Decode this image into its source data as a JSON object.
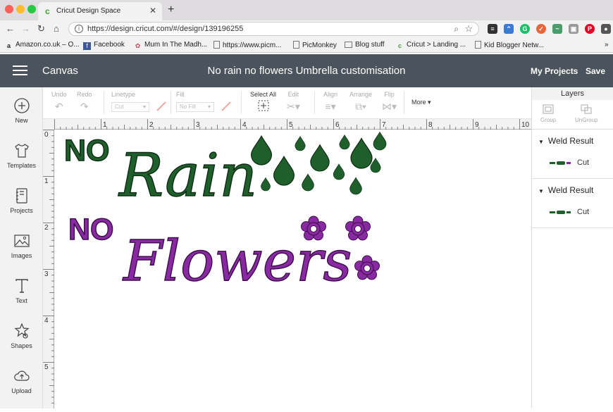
{
  "browser": {
    "tab_title": "Cricut Design Space",
    "url": "https://design.cricut.com/#/design/139196255",
    "bookmarks": [
      {
        "label": "Amazon.co.uk – O..."
      },
      {
        "label": "Facebook"
      },
      {
        "label": "Mum In The Madh..."
      },
      {
        "label": "https://www.picm..."
      },
      {
        "label": "PicMonkey"
      },
      {
        "label": "Blog stuff"
      },
      {
        "label": "Cricut > Landing ..."
      },
      {
        "label": "Kid Blogger Netw..."
      }
    ]
  },
  "app": {
    "section": "Canvas",
    "project_title": "No rain no flowers Umbrella customisation",
    "my_projects_label": "My Projects",
    "save_label": "Save"
  },
  "sidebar": {
    "items": [
      {
        "label": "New",
        "icon": "plus-circle-icon"
      },
      {
        "label": "Templates",
        "icon": "shirt-icon"
      },
      {
        "label": "Projects",
        "icon": "notebook-icon"
      },
      {
        "label": "Images",
        "icon": "image-icon"
      },
      {
        "label": "Text",
        "icon": "text-t-icon"
      },
      {
        "label": "Shapes",
        "icon": "shapes-icon"
      },
      {
        "label": "Upload",
        "icon": "cloud-upload-icon"
      }
    ]
  },
  "toolbar": {
    "undo": "Undo",
    "redo": "Redo",
    "linetype": "Linetype",
    "linetype_value": "Cut",
    "fill": "Fill",
    "fill_value": "No Fill",
    "select_all": "Select All",
    "edit": "Edit",
    "align": "Align",
    "arrange": "Arrange",
    "flip": "Flip",
    "more": "More"
  },
  "ruler": {
    "h_labels": [
      "1",
      "2",
      "3",
      "4",
      "5",
      "6",
      "7",
      "8",
      "9",
      "10"
    ],
    "v_labels": [
      "0",
      "1",
      "2",
      "3",
      "4",
      "5"
    ]
  },
  "canvas": {
    "line1_small": "NO",
    "line1_script": "Rain",
    "line2_small": "NO",
    "line2_script": "Flowers",
    "rain_color": "#1f5f2c",
    "flower_color": "#8a2aa3"
  },
  "layers": {
    "header": "Layers",
    "group_label": "Group",
    "ungroup_label": "UnGroup",
    "groups": [
      {
        "name": "Weld Result",
        "type": "Cut",
        "color": "#1f5f2c"
      },
      {
        "name": "Weld Result",
        "type": "Cut",
        "color": "#8a2aa3"
      }
    ]
  }
}
